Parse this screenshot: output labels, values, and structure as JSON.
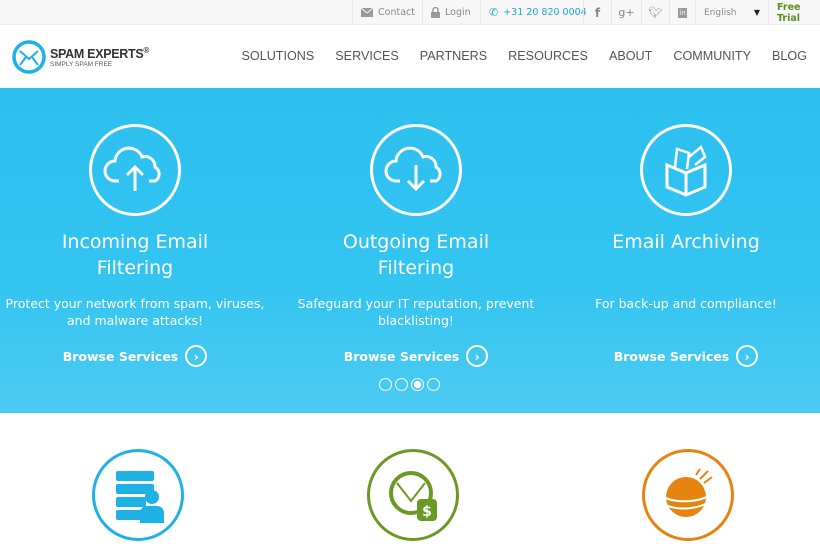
{
  "topbar": {
    "contact": "Contact",
    "login": "Login",
    "phone": "+31 20 820 0004",
    "language": "English",
    "free_trial": "Free Trial"
  },
  "logo": {
    "name": "SPAM EXPERTS",
    "reg": "®",
    "tagline": "SIMPLY SPAM FREE"
  },
  "nav": [
    "SOLUTIONS",
    "SERVICES",
    "PARTNERS",
    "RESOURCES",
    "ABOUT",
    "COMMUNITY",
    "BLOG"
  ],
  "hero": {
    "slides": [
      {
        "title1": "Incoming Email",
        "title2": "Filtering",
        "desc1": "Protect your network from spam, viruses,",
        "desc2": "and malware attacks!",
        "link": "Browse Services",
        "icon": "cloud-upload-icon"
      },
      {
        "title1": "Outgoing Email",
        "title2": "Filtering",
        "desc1": "Safeguard your IT reputation, prevent",
        "desc2": "blacklisting!",
        "link": "Browse Services",
        "icon": "cloud-download-icon"
      },
      {
        "title1": "Email Archiving",
        "title2": "",
        "desc1": "For back-up and compliance!",
        "desc2": "",
        "link": "Browse Services",
        "icon": "archive-box-icon"
      }
    ],
    "carousel_active": 3,
    "carousel_count": 4
  },
  "colors": {
    "hero": "#2cc0ef",
    "phone": "#1aa9d8",
    "free_trial": "#5a8f1e",
    "blue": "#1eb1e4",
    "green": "#6a9a25",
    "orange": "#e5840f"
  }
}
